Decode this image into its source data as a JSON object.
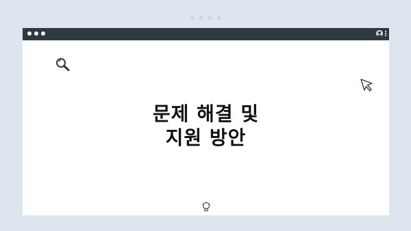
{
  "headline": {
    "line1": "문제 해결 및",
    "line2": "지원 방안"
  },
  "icons": {
    "window_controls": [
      "dot",
      "dot",
      "dot"
    ],
    "top_indicators": [
      "dot",
      "dot",
      "dot",
      "dot"
    ],
    "search": "search-icon",
    "cursor": "cursor-arrow-icon",
    "user": "user-icon",
    "menu": "kebab-menu-icon",
    "bulb": "light-bulb-icon"
  },
  "colors": {
    "background": "#dde5ee",
    "titlebar": "#2f3a40",
    "window": "#ffffff",
    "text": "#111111"
  }
}
